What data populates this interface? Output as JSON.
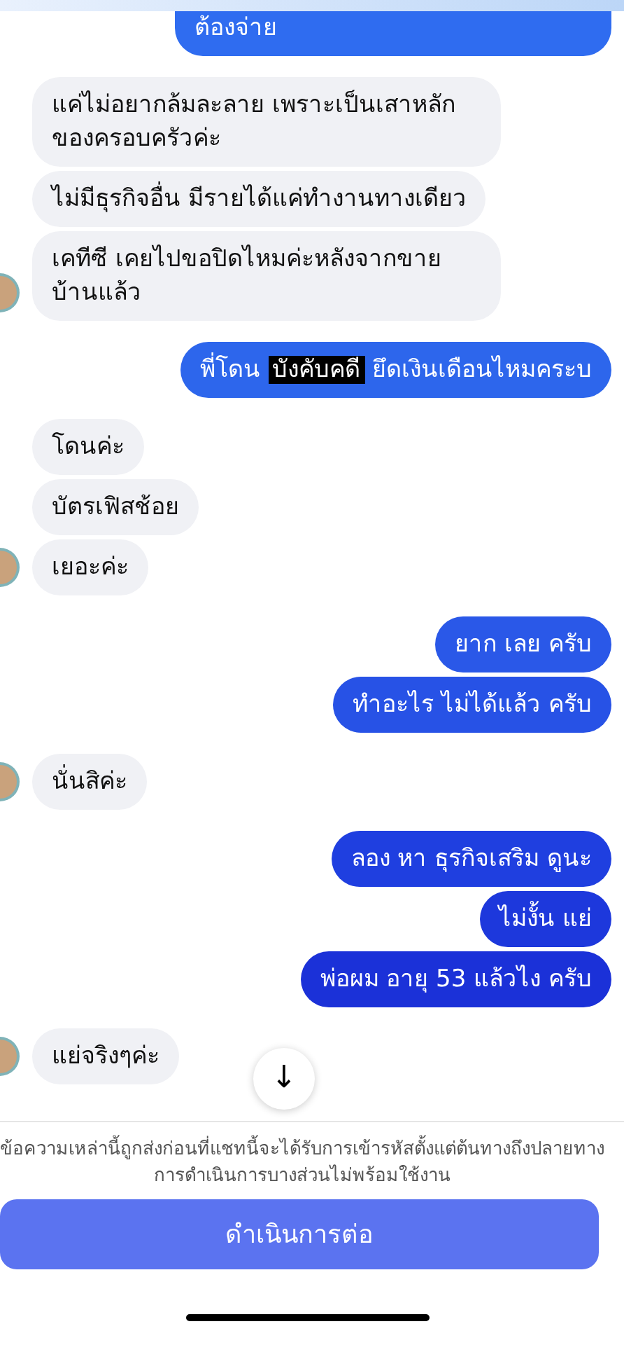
{
  "messages": [
    {
      "kind": "outgoing",
      "text": "ต้องจ่าย",
      "color": "#2f6cf0",
      "cut_top": true
    },
    {
      "kind": "incoming",
      "text": "แค่ไม่อยากล้มละลาย เพราะเป็นเสาหลักของครอบครัวค่ะ",
      "show_avatar": false
    },
    {
      "kind": "incoming",
      "text": "ไม่มีธุรกิจอื่น มีรายได้แค่ทำงานทางเดียว",
      "show_avatar": false
    },
    {
      "kind": "incoming",
      "text": "เคทีซี เคยไปขอปิดไหมค่ะหลังจากขายบ้านแล้ว",
      "show_avatar": true
    },
    {
      "kind": "outgoing",
      "parts": [
        {
          "text": "พี่โดน ",
          "highlighted": false
        },
        {
          "text": "บังคับคดี",
          "highlighted": true
        },
        {
          "text": " ยึดเงินเดือนไหมคระบ",
          "highlighted": false
        }
      ],
      "color": "#2d66ec"
    },
    {
      "kind": "incoming",
      "text": "โดนค่ะ",
      "show_avatar": false
    },
    {
      "kind": "incoming",
      "text": "บัตรเฟิสช้อย",
      "show_avatar": false
    },
    {
      "kind": "incoming",
      "text": "เยอะค่ะ",
      "show_avatar": true
    },
    {
      "kind": "outgoing",
      "text": "ยาก เลย ครับ",
      "color": "#2a58e8"
    },
    {
      "kind": "outgoing",
      "text": "ทำอะไร ไม่ได้แล้ว ครับ",
      "color": "#2752e6"
    },
    {
      "kind": "incoming",
      "text": "นั่นสิค่ะ",
      "show_avatar": true
    },
    {
      "kind": "outgoing",
      "text": "ลอง หา ธุรกิจเสริม ดูนะ",
      "color": "#1f3fe0"
    },
    {
      "kind": "outgoing",
      "text": "ไม่งั้น แย่",
      "color": "#1d38dc"
    },
    {
      "kind": "outgoing",
      "text": "พ่อผม อายุ 53 แล้วไง ครับ",
      "color": "#1b31d8"
    },
    {
      "kind": "incoming",
      "text": "แย่จริงๆค่ะ",
      "show_avatar": true
    }
  ],
  "scroll_button": {
    "icon": "↓"
  },
  "notice": "ข้อความเหล่านี้ถูกส่งก่อนที่แชทนี้จะได้รับการเข้ารหัสตั้งแต่ต้นทางถึงปลายทาง การดำเนินการบางส่วนไม่พร้อมใช้งาน",
  "continue_button": {
    "label": "ดำเนินการต่อ"
  }
}
